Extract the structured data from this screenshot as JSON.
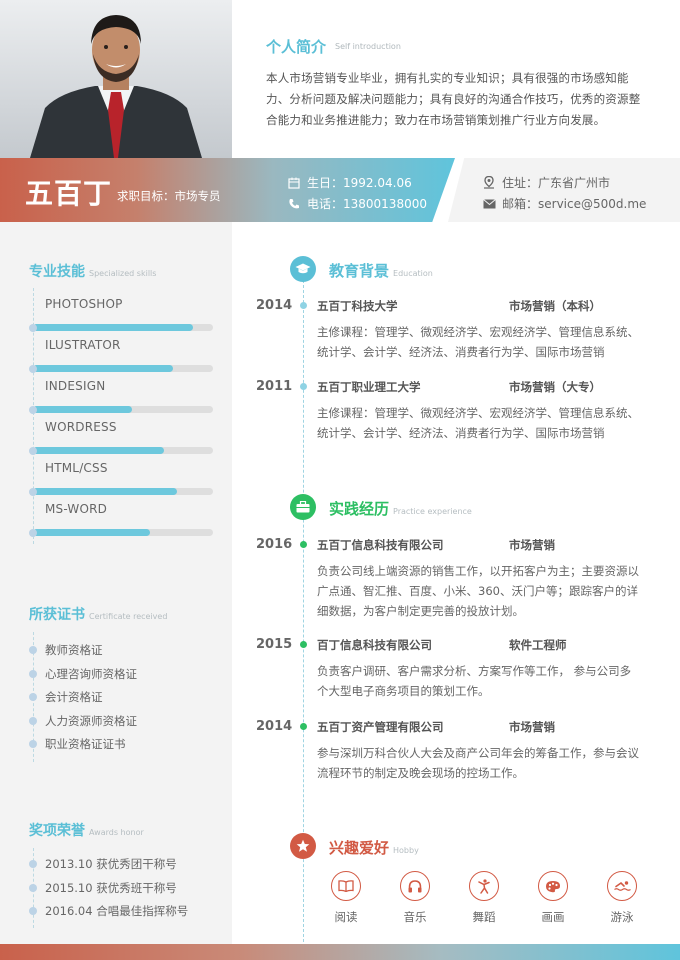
{
  "intro": {
    "title": "个人简介",
    "subtitle": "Self introduction",
    "text": "本人市场营销专业毕业，拥有扎实的专业知识；具有很强的市场感知能力、分析问题及解决问题能力；具有良好的沟通合作技巧，优秀的资源整合能力和业务推进能力；致力在市场营销策划推广行业方向发展。"
  },
  "banner": {
    "name": "五百丁",
    "objective": "求职目标：市场专员",
    "birth": "生日：1992.04.06",
    "phone": "电话：13800138000",
    "address": "住址：广东省广州市",
    "email": "邮箱：service@500d.me"
  },
  "skills": {
    "title": "专业技能",
    "subtitle": "Specialized skills",
    "items": [
      {
        "label": "PHOTOSHOP",
        "level": 0.89
      },
      {
        "label": "ILUSTRATOR",
        "level": 0.78
      },
      {
        "label": "INDESIGN",
        "level": 0.55
      },
      {
        "label": "WORDRESS",
        "level": 0.73
      },
      {
        "label": "HTML/CSS",
        "level": 0.8
      },
      {
        "label": "MS-WORD",
        "level": 0.65
      }
    ]
  },
  "certificates": {
    "title": "所获证书",
    "subtitle": "Certificate received",
    "items": [
      "教师资格证",
      "心理咨询师资格证",
      "会计资格证",
      "人力资源师资格证",
      "职业资格证证书"
    ]
  },
  "awards": {
    "title": "奖项荣誉",
    "subtitle": "Awards honor",
    "items": [
      "2013.10  获优秀团干称号",
      "2015.10  获优秀班干称号",
      "2016.04  合唱最佳指挥称号"
    ]
  },
  "education": {
    "title": "教育背景",
    "subtitle": "Education",
    "entries": [
      {
        "year": "2014",
        "school": "五百丁科技大学",
        "major": "市场营销（本科）",
        "desc": "主修课程：管理学、微观经济学、宏观经济学、管理信息系统、统计学、会计学、经济法、消费者行为学、国际市场营销"
      },
      {
        "year": "2011",
        "school": "五百丁职业理工大学",
        "major": "市场营销（大专）",
        "desc": "主修课程：管理学、微观经济学、宏观经济学、管理信息系统、统计学、会计学、经济法、消费者行为学、国际市场营销"
      }
    ]
  },
  "experience": {
    "title": "实践经历",
    "subtitle": "Practice experience",
    "entries": [
      {
        "year": "2016",
        "company": "五百丁信息科技有限公司",
        "role": "市场营销",
        "desc": "负责公司线上端资源的销售工作，以开拓客户为主；主要资源以广点通、智汇推、百度、小米、360、沃门户等；跟踪客户的详细数据，为客户制定更完善的投放计划。"
      },
      {
        "year": "2015",
        "company": "百丁信息科技有限公司",
        "role": "软件工程师",
        "desc": "负责客户调研、客户需求分析、方案写作等工作， 参与公司多个大型电子商务项目的策划工作。"
      },
      {
        "year": "2014",
        "company": "五百丁资产管理有限公司",
        "role": "市场营销",
        "desc": "参与深圳万科合伙人大会及商产公司年会的筹备工作，参与会议流程环节的制定及晚会现场的控场工作。"
      }
    ]
  },
  "hobbies": {
    "title": "兴趣爱好",
    "subtitle": "Hobby",
    "items": [
      {
        "label": "阅读",
        "icon": "book-icon"
      },
      {
        "label": "音乐",
        "icon": "headphones-icon"
      },
      {
        "label": "舞蹈",
        "icon": "dance-icon"
      },
      {
        "label": "画画",
        "icon": "palette-icon"
      },
      {
        "label": "游泳",
        "icon": "swim-icon"
      }
    ]
  },
  "colors": {
    "accent_blue": "#5bbfd6",
    "accent_green": "#2dbf63",
    "accent_red": "#d25a44"
  }
}
